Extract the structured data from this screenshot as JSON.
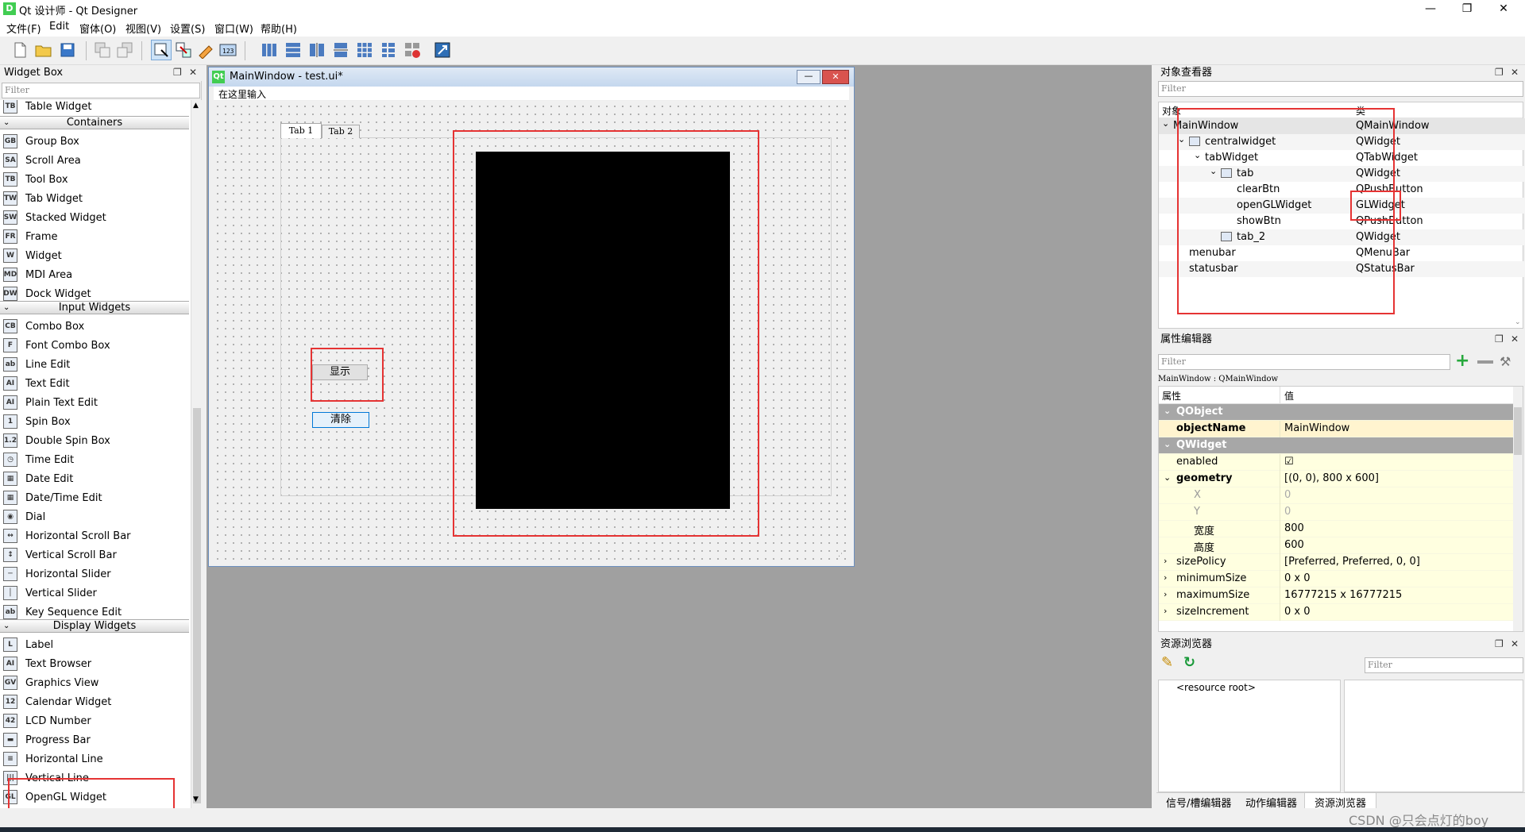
{
  "window": {
    "title": "Qt 设计师 - Qt Designer",
    "logo": "D"
  },
  "menu": [
    "文件(F)",
    "Edit",
    "窗体(O)",
    "视图(V)",
    "设置(S)",
    "窗口(W)",
    "帮助(H)"
  ],
  "widget_box": {
    "title": "Widget Box",
    "filter_placeholder": "Filter",
    "items_top": [
      {
        "label": "Table Widget",
        "icon": "TB"
      }
    ],
    "categories": [
      {
        "name": "Containers",
        "items": [
          {
            "label": "Group Box",
            "icon": "GB"
          },
          {
            "label": "Scroll Area",
            "icon": "SA"
          },
          {
            "label": "Tool Box",
            "icon": "TB"
          },
          {
            "label": "Tab Widget",
            "icon": "TW"
          },
          {
            "label": "Stacked Widget",
            "icon": "SW"
          },
          {
            "label": "Frame",
            "icon": "FR"
          },
          {
            "label": "Widget",
            "icon": "W"
          },
          {
            "label": "MDI Area",
            "icon": "MD"
          },
          {
            "label": "Dock Widget",
            "icon": "DW"
          }
        ]
      },
      {
        "name": "Input Widgets",
        "items": [
          {
            "label": "Combo Box",
            "icon": "CB"
          },
          {
            "label": "Font Combo Box",
            "icon": "F"
          },
          {
            "label": "Line Edit",
            "icon": "ab"
          },
          {
            "label": "Text Edit",
            "icon": "AI"
          },
          {
            "label": "Plain Text Edit",
            "icon": "AI"
          },
          {
            "label": "Spin Box",
            "icon": "1"
          },
          {
            "label": "Double Spin Box",
            "icon": "1.2"
          },
          {
            "label": "Time Edit",
            "icon": "◷"
          },
          {
            "label": "Date Edit",
            "icon": "▦"
          },
          {
            "label": "Date/Time Edit",
            "icon": "▦"
          },
          {
            "label": "Dial",
            "icon": "◉"
          },
          {
            "label": "Horizontal Scroll Bar",
            "icon": "↔"
          },
          {
            "label": "Vertical Scroll Bar",
            "icon": "↕"
          },
          {
            "label": "Horizontal Slider",
            "icon": "─"
          },
          {
            "label": "Vertical Slider",
            "icon": "│"
          },
          {
            "label": "Key Sequence Edit",
            "icon": "ab"
          }
        ]
      },
      {
        "name": "Display Widgets",
        "items": [
          {
            "label": "Label",
            "icon": "L"
          },
          {
            "label": "Text Browser",
            "icon": "AI"
          },
          {
            "label": "Graphics View",
            "icon": "GV"
          },
          {
            "label": "Calendar Widget",
            "icon": "12"
          },
          {
            "label": "LCD Number",
            "icon": "42"
          },
          {
            "label": "Progress Bar",
            "icon": "▬"
          },
          {
            "label": "Horizontal Line",
            "icon": "≡"
          },
          {
            "label": "Vertical Line",
            "icon": "|||"
          },
          {
            "label": "OpenGL Widget",
            "icon": "GL"
          }
        ]
      }
    ]
  },
  "form": {
    "title": "MainWindow - test.ui*",
    "menu_placeholder": "在这里输入",
    "tabs": [
      "Tab 1",
      "Tab 2"
    ],
    "show_button": "显示",
    "clear_button": "清除"
  },
  "object_inspector": {
    "title": "对象查看器",
    "filter_placeholder": "Filter",
    "col_object": "对象",
    "col_class": "类",
    "rows": [
      {
        "name": "MainWindow",
        "cls": "QMainWindow",
        "indent": 0,
        "arrow": "⌄"
      },
      {
        "name": "centralwidget",
        "cls": "QWidget",
        "indent": 1,
        "arrow": "⌄"
      },
      {
        "name": "tabWidget",
        "cls": "QTabWidget",
        "indent": 2,
        "arrow": "⌄"
      },
      {
        "name": "tab",
        "cls": "QWidget",
        "indent": 3,
        "arrow": "⌄"
      },
      {
        "name": "clearBtn",
        "cls": "QPushButton",
        "indent": 4,
        "arrow": ""
      },
      {
        "name": "openGLWidget",
        "cls": "GLWidget",
        "indent": 4,
        "arrow": ""
      },
      {
        "name": "showBtn",
        "cls": "QPushButton",
        "indent": 4,
        "arrow": ""
      },
      {
        "name": "tab_2",
        "cls": "QWidget",
        "indent": 3,
        "arrow": ""
      },
      {
        "name": "menubar",
        "cls": "QMenuBar",
        "indent": 1,
        "arrow": ""
      },
      {
        "name": "statusbar",
        "cls": "QStatusBar",
        "indent": 1,
        "arrow": ""
      }
    ]
  },
  "property_editor": {
    "title": "属性编辑器",
    "filter_placeholder": "Filter",
    "context": "MainWindow : QMainWindow",
    "col_prop": "属性",
    "col_value": "值",
    "rows": [
      {
        "name": "QObject",
        "value": "",
        "group": true
      },
      {
        "name": "objectName",
        "value": "MainWindow",
        "bold": true
      },
      {
        "name": "QWidget",
        "value": "",
        "group": true
      },
      {
        "name": "enabled",
        "value": "☑"
      },
      {
        "name": "geometry",
        "value": "[(0, 0), 800 x 600]",
        "bold": true,
        "arrow": "⌄"
      },
      {
        "name": "X",
        "value": "0",
        "sub": true,
        "dim": true
      },
      {
        "name": "Y",
        "value": "0",
        "sub": true,
        "dim": true
      },
      {
        "name": "宽度",
        "value": "800",
        "sub": true
      },
      {
        "name": "高度",
        "value": "600",
        "sub": true
      },
      {
        "name": "sizePolicy",
        "value": "[Preferred, Preferred, 0, 0]",
        "arrow": "›"
      },
      {
        "name": "minimumSize",
        "value": "0 x 0",
        "arrow": "›"
      },
      {
        "name": "maximumSize",
        "value": "16777215 x 16777215",
        "arrow": "›"
      },
      {
        "name": "sizeIncrement",
        "value": "0 x 0",
        "arrow": "›"
      }
    ]
  },
  "resource_browser": {
    "title": "资源浏览器",
    "filter_placeholder": "Filter",
    "root": "<resource root>",
    "tabs": [
      "信号/槽编辑器",
      "动作编辑器",
      "资源浏览器"
    ]
  },
  "watermark": "CSDN @只会点灯的boy",
  "colors": {
    "highlight": "#e53333",
    "group_bg": "#a7a7a7",
    "prop_bg": "#ffffe0"
  }
}
